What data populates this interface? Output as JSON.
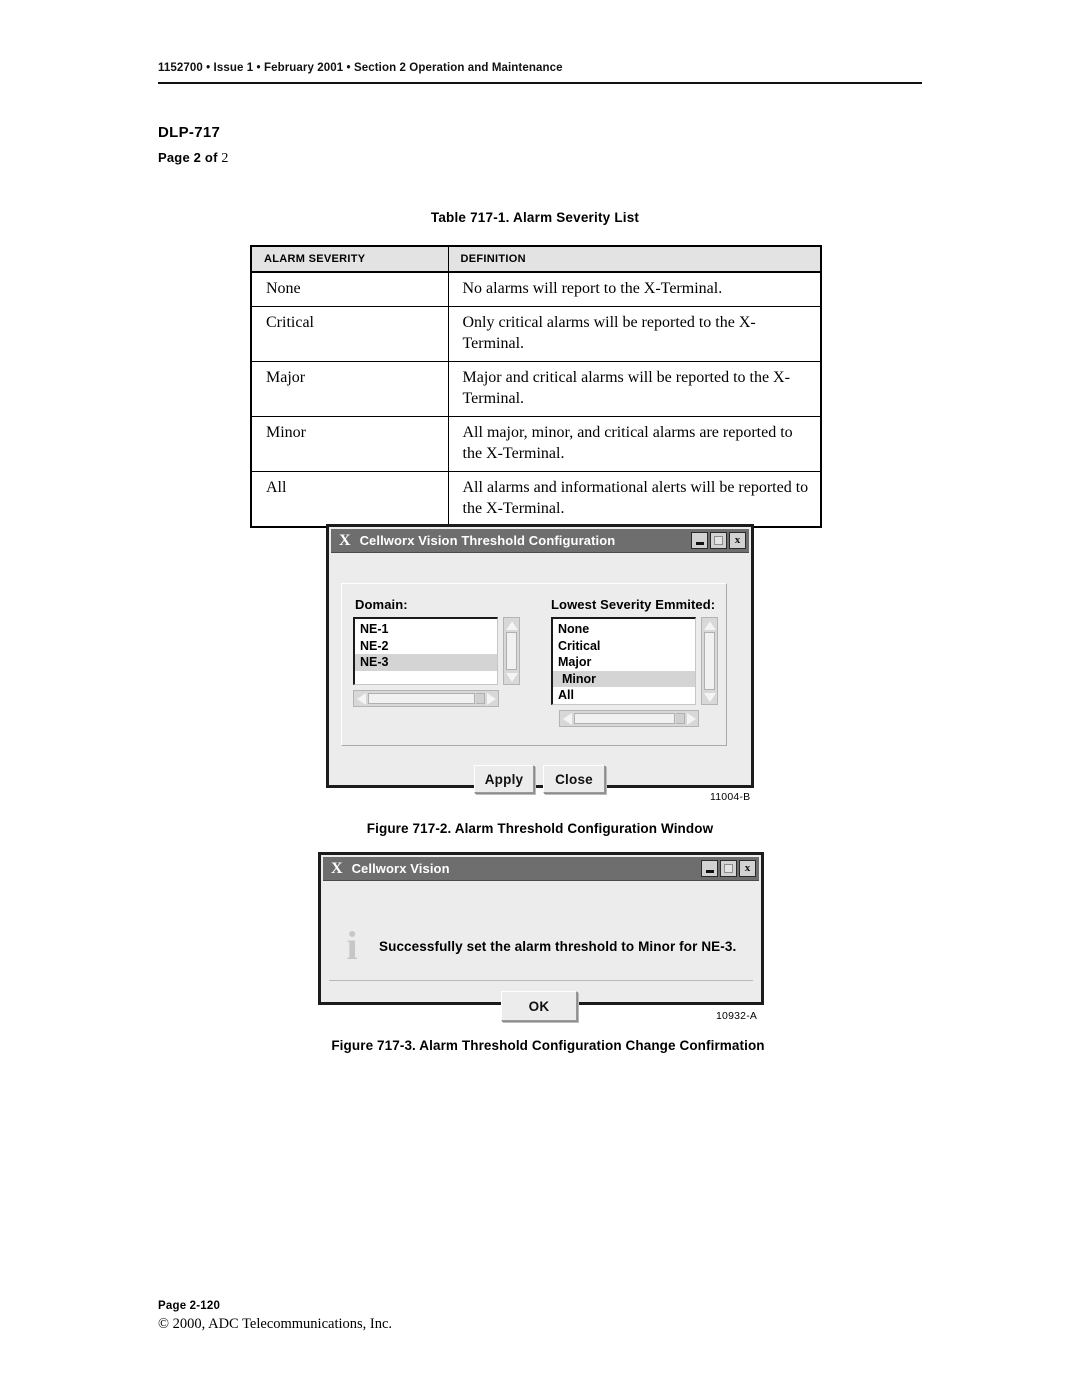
{
  "header": {
    "text": "1152700 • Issue 1 • February 2001 • Section 2 Operation and Maintenance"
  },
  "doc": {
    "dlp_title": "DLP-717",
    "page_of_label": "Page 2 of",
    "page_of_value": "2"
  },
  "table": {
    "caption": "Table 717-1. Alarm Severity List",
    "columns": [
      "ALARM SEVERITY",
      "DEFINITION"
    ],
    "rows": [
      {
        "severity": "None",
        "definition": "No alarms will report to the X-Terminal."
      },
      {
        "severity": "Critical",
        "definition": "Only critical alarms will be reported to the X-Terminal."
      },
      {
        "severity": "Major",
        "definition": "Major and critical alarms will be reported to the X-Terminal."
      },
      {
        "severity": "Minor",
        "definition": "All major, minor, and critical alarms are reported to the X-Terminal."
      },
      {
        "severity": "All",
        "definition": "All alarms and informational alerts will be reported to the X-Terminal."
      }
    ]
  },
  "figure1": {
    "id_label": "11004-B",
    "caption": "Figure 717-2. Alarm Threshold Configuration Window",
    "window": {
      "x_icon": "X",
      "title": "Cellworx Vision Threshold Configuration",
      "minimize_icon": "minimize-icon",
      "maximize_icon": "maximize-icon",
      "close_icon": "x",
      "domain": {
        "label": "Domain:",
        "items": [
          "NE-1",
          "NE-2",
          "NE-3"
        ],
        "selected": "NE-3"
      },
      "severity": {
        "label": "Lowest Severity Emmited:",
        "items": [
          "None",
          "Critical",
          "Major",
          "Minor",
          "All"
        ],
        "selected": "Minor"
      },
      "buttons": {
        "apply": "Apply",
        "close": "Close"
      }
    }
  },
  "figure2": {
    "id_label": "10932-A",
    "caption": "Figure 717-3. Alarm Threshold Configuration Change Confirmation",
    "window": {
      "x_icon": "X",
      "title": "Cellworx Vision",
      "close_icon": "x",
      "info_icon": "i",
      "message": "Successfully set the alarm threshold to Minor for NE-3.",
      "ok_label": "OK"
    }
  },
  "footer": {
    "page": "Page 2-120",
    "copyright": "© 2000, ADC Telecommunications, Inc."
  }
}
